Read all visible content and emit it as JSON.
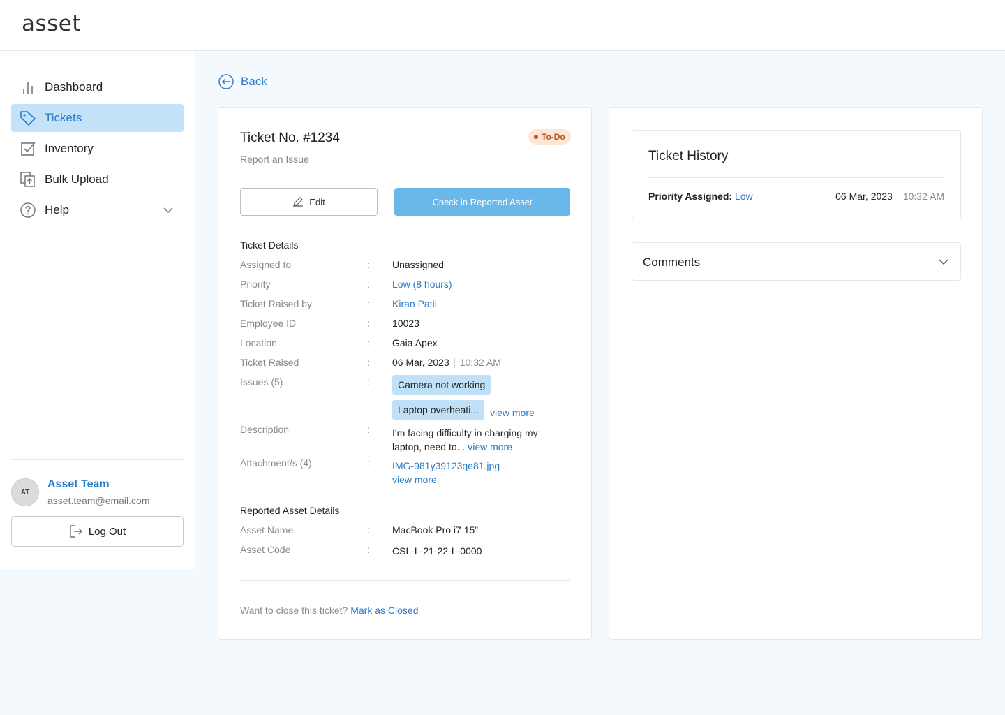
{
  "app": {
    "logo": "asset"
  },
  "sidebar": {
    "items": [
      {
        "label": "Dashboard",
        "icon": "bar-chart-icon"
      },
      {
        "label": "Tickets",
        "icon": "tag-icon",
        "active": true
      },
      {
        "label": "Inventory",
        "icon": "checkbox-icon"
      },
      {
        "label": "Bulk Upload",
        "icon": "upload-icon"
      },
      {
        "label": "Help",
        "icon": "help-icon"
      }
    ],
    "user": {
      "initials": "AT",
      "name": "Asset Team",
      "email": "asset.team@email.com"
    },
    "logout_label": "Log Out"
  },
  "back_label": "Back",
  "ticket": {
    "title": "Ticket No. #1234",
    "subtitle": "Report an Issue",
    "status": "To-Do",
    "edit_label": "Edit",
    "checkin_label": "Check in Reported Asset",
    "details_title": "Ticket Details",
    "details": {
      "assigned_to": {
        "label": "Assigned to",
        "value": "Unassigned"
      },
      "priority": {
        "label": "Priority",
        "value": "Low (8 hours)"
      },
      "raised_by": {
        "label": "Ticket Raised by",
        "value": "Kiran Patil"
      },
      "employee_id": {
        "label": "Employee ID",
        "value": "10023"
      },
      "location": {
        "label": "Location",
        "value": "Gaia Apex"
      },
      "raised": {
        "label": "Ticket Raised",
        "date": "06 Mar, 2023",
        "time": "10:32 AM"
      },
      "issues": {
        "label": "Issues (5)",
        "chips": [
          "Camera not working",
          "Laptop overheati..."
        ],
        "more": "view more"
      },
      "description": {
        "label": "Description",
        "text": "I'm facing difficulty in charging my laptop, need to...",
        "more": "view more"
      },
      "attachments": {
        "label": "Attachment/s (4)",
        "file": "IMG-981y39123qe81.jpg",
        "more": "view more"
      }
    },
    "asset_title": "Reported Asset Details",
    "asset": {
      "name": {
        "label": "Asset Name",
        "value": "MacBook Pro i7 15”"
      },
      "code": {
        "label": "Asset Code",
        "value": "CSL-L-21-22-L-0000"
      }
    },
    "close_question": "Want to close this ticket?",
    "close_link": "Mark as Closed"
  },
  "history": {
    "title": "Ticket History",
    "priority_label": "Priority Assigned:",
    "priority_value": "Low",
    "date": "06 Mar, 2023",
    "time": "10:32 AM"
  },
  "comments": {
    "title": "Comments"
  },
  "colors": {
    "accent": "#2a7bc8",
    "active_bg": "#c4e2f8",
    "primary_btn": "#6ab8ea",
    "badge_bg": "#fde6d4",
    "badge_text": "#b8531f"
  }
}
